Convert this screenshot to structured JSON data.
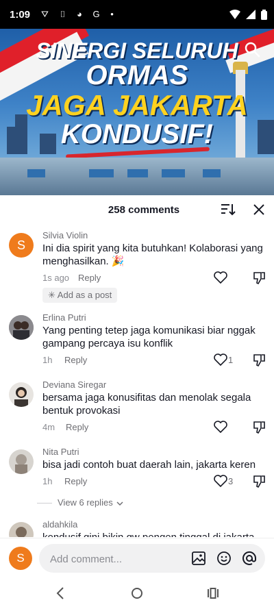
{
  "status_bar": {
    "time": "1:09",
    "left_icons": "⛛ ▯ ◕ G •",
    "right_icons": "▾◢▮"
  },
  "video": {
    "headline_lines": [
      "SINERGI SELURUH",
      "ORMAS",
      "JAGA JAKARTA",
      "KONDUSIF!"
    ],
    "search_icon": "search-icon"
  },
  "sheet": {
    "comments_count": "258 comments",
    "sort_icon": "sort-icon",
    "close_icon": "close-icon"
  },
  "comments": [
    {
      "username": "Silvia Violin",
      "avatar_letter": "S",
      "text": "Ini dia spirit yang kita butuhkan! Kolaborasi yang menghasilkan. 🎉",
      "time": "1s ago",
      "reply_label": "Reply",
      "likes": "",
      "add_post_label": "✳ Add as a post"
    },
    {
      "username": "Erlina Putri",
      "text": "Yang penting tetep jaga komunikasi biar nggak gampang percaya isu konflik",
      "time": "1h",
      "reply_label": "Reply",
      "likes": "1"
    },
    {
      "username": "Deviana Siregar",
      "text": "bersama jaga konusifitas dan menolak segala bentuk provokasi",
      "time": "4m",
      "reply_label": "Reply",
      "likes": ""
    },
    {
      "username": "Nita Putri",
      "text": "bisa jadi contoh buat daerah lain, jakarta keren",
      "time": "1h",
      "reply_label": "Reply",
      "likes": "3",
      "view_replies_label": "View 6 replies"
    },
    {
      "username": "aldahkila",
      "text": "kondusif gini bikin gw pengen tinggal di jakarta",
      "time": "",
      "reply_label": "",
      "likes": ""
    }
  ],
  "composer": {
    "avatar_letter": "S",
    "placeholder": "Add comment...",
    "icons": [
      "image-icon",
      "emoji-icon",
      "mention-icon"
    ]
  },
  "nav_bar": {
    "icons": [
      "back-icon",
      "home-icon",
      "recents-icon"
    ]
  }
}
